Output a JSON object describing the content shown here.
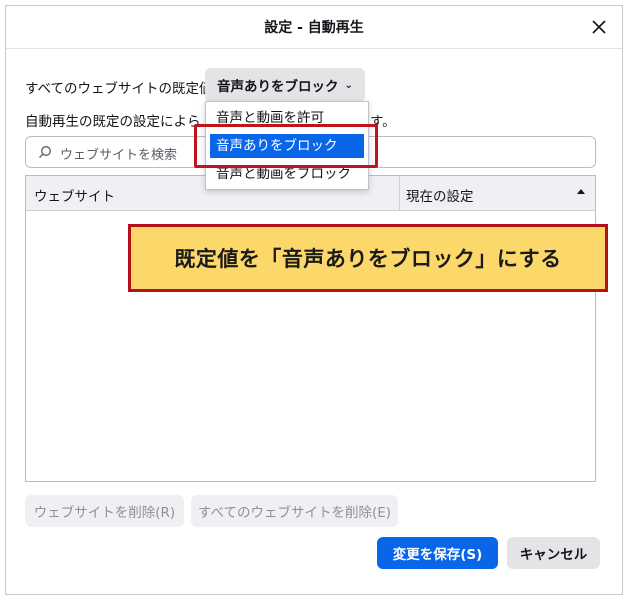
{
  "dialog": {
    "title": "設定 - 自動再生",
    "close_icon": "close-icon"
  },
  "default_setting": {
    "label": "すべてのウェブサイトの既定値:",
    "selected": "音声ありをブロック",
    "chevron": "⌄",
    "options": [
      "音声と動画を許可",
      "音声ありをブロック",
      "音声と動画をブロック"
    ]
  },
  "description": {
    "visible_start": "自動再生の既定の設定によら",
    "visible_end": "す。"
  },
  "search": {
    "placeholder": "ウェブサイトを検索"
  },
  "table": {
    "columns": [
      "ウェブサイト",
      "現在の設定"
    ],
    "sort_indicator": "ascending",
    "rows": []
  },
  "callout": {
    "text": "既定値を「音声ありをブロック」にする",
    "background": "#fcd86a",
    "border": "#b3121a"
  },
  "buttons": {
    "remove_site": "ウェブサイトを削除(R)",
    "remove_all": "すべてのウェブサイトを削除(E)",
    "save": "変更を保存(S)",
    "cancel": "キャンセル"
  },
  "colors": {
    "accent": "#0a66e8",
    "highlight": "#c0141c"
  }
}
